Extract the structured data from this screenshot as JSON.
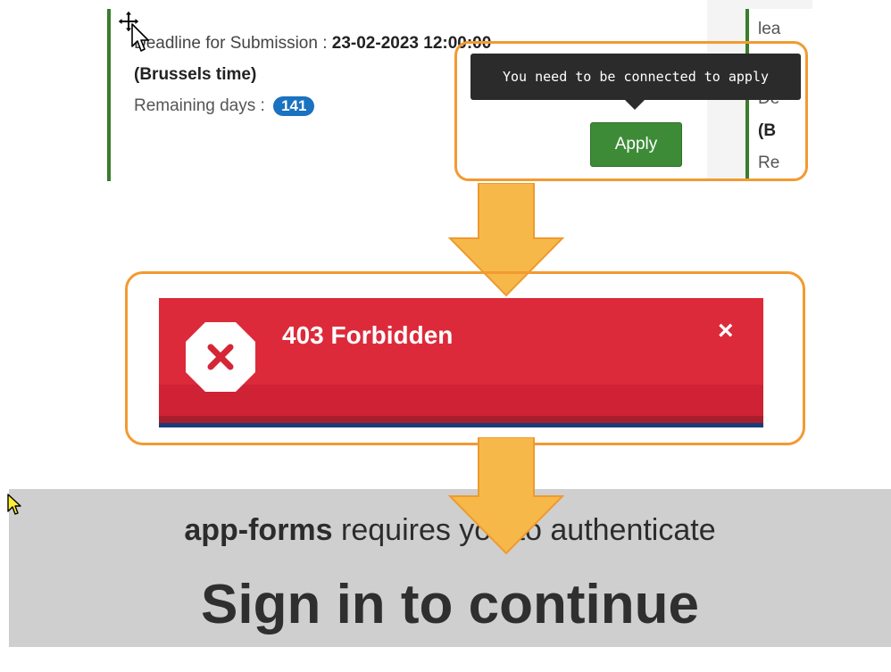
{
  "card": {
    "deadline_label": "Deadline for Submission : ",
    "deadline_value": "23-02-2023 12:00:00",
    "timezone": "(Brussels time)",
    "remaining_label": "Remaining days : ",
    "remaining_days": "141",
    "apply_label": "Apply",
    "tooltip": "You need to be connected to apply",
    "right_fragments": [
      "lea",
      "De",
      "(B",
      "Re"
    ]
  },
  "error_banner": {
    "title": "403 Forbidden",
    "close_symbol": "×",
    "icon": "stop-error-icon"
  },
  "auth_page": {
    "app_name": "app-forms",
    "requirement_text": " requires you to authenticate",
    "title": "Sign in to continue"
  },
  "colors": {
    "accent_orange": "#f39a31",
    "apply_green": "#3d8b37",
    "card_border_green": "#3a7d2c",
    "badge_blue": "#1a72c0",
    "error_red": "#dc2a3a",
    "signin_gray": "#cfcfcf"
  },
  "icons": [
    "move-cursor-icon",
    "arrow-cursor-icon",
    "stop-error-icon",
    "close-icon",
    "down-arrow-icon",
    "yellow-cursor-icon"
  ]
}
